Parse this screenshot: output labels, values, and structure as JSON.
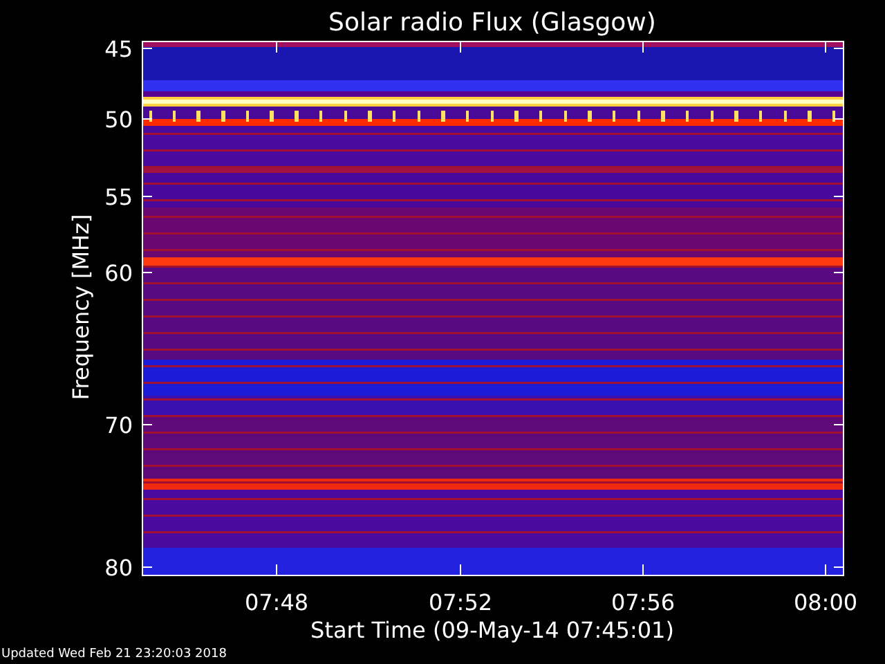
{
  "title": "Solar radio Flux (Glasgow)",
  "y_axis": {
    "label": "Frequency [MHz]",
    "ticks": [
      "45",
      "50",
      "55",
      "60",
      "70",
      "80"
    ]
  },
  "x_axis": {
    "label": "Start Time (09-May-14 07:45:01)",
    "ticks": [
      "07:48",
      "07:52",
      "07:56",
      "08:00"
    ]
  },
  "footer": "Updated Wed Feb 21 23:20:03 2018"
}
